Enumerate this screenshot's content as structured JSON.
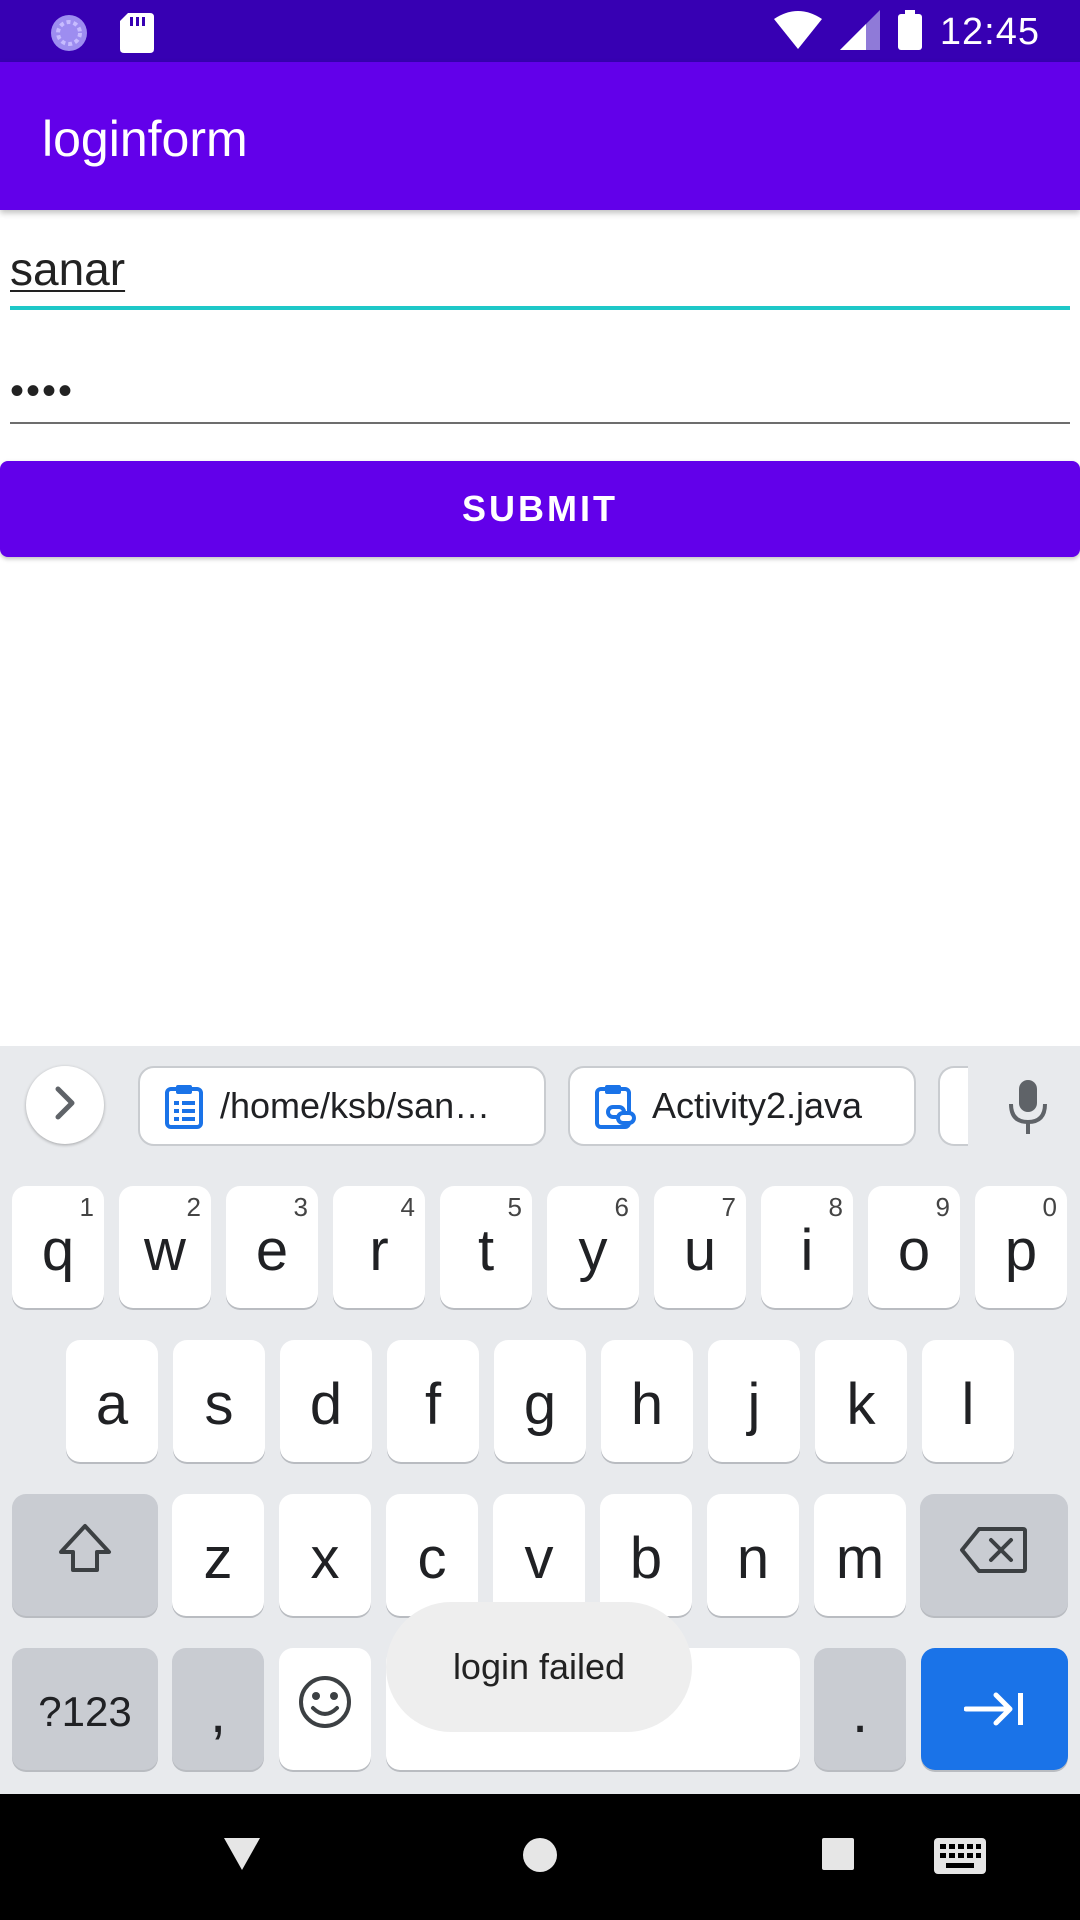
{
  "status_bar": {
    "time": "12:45",
    "icons": [
      "sync-icon",
      "sd-card-icon",
      "wifi-icon",
      "signal-icon",
      "battery-icon"
    ]
  },
  "app_bar": {
    "title": "loginform"
  },
  "form": {
    "username_value": "sanar",
    "password_value": "••••",
    "submit_label": "SUBMIT",
    "accent_color": "#1ec8c8"
  },
  "keyboard": {
    "clipboard_chips": [
      {
        "label": "/home/ksb/san…",
        "icon": "clipboard-icon"
      },
      {
        "label": "Activity2.java",
        "icon": "clipboard-link-icon"
      }
    ],
    "row1": [
      {
        "key": "q",
        "hint": "1"
      },
      {
        "key": "w",
        "hint": "2"
      },
      {
        "key": "e",
        "hint": "3"
      },
      {
        "key": "r",
        "hint": "4"
      },
      {
        "key": "t",
        "hint": "5"
      },
      {
        "key": "y",
        "hint": "6"
      },
      {
        "key": "u",
        "hint": "7"
      },
      {
        "key": "i",
        "hint": "8"
      },
      {
        "key": "o",
        "hint": "9"
      },
      {
        "key": "p",
        "hint": "0"
      }
    ],
    "row2": [
      "a",
      "s",
      "d",
      "f",
      "g",
      "h",
      "j",
      "k",
      "l"
    ],
    "row3": [
      "z",
      "x",
      "c",
      "v",
      "b",
      "n",
      "m"
    ],
    "row4": {
      "symbols": "?123",
      "comma": ",",
      "period": "."
    },
    "colors": {
      "enter": "#1a73e8",
      "background": "#e8eaed"
    }
  },
  "toast": {
    "message": "login failed"
  },
  "colors": {
    "primary": "#6200ea",
    "primary_dark": "#3700b3"
  }
}
